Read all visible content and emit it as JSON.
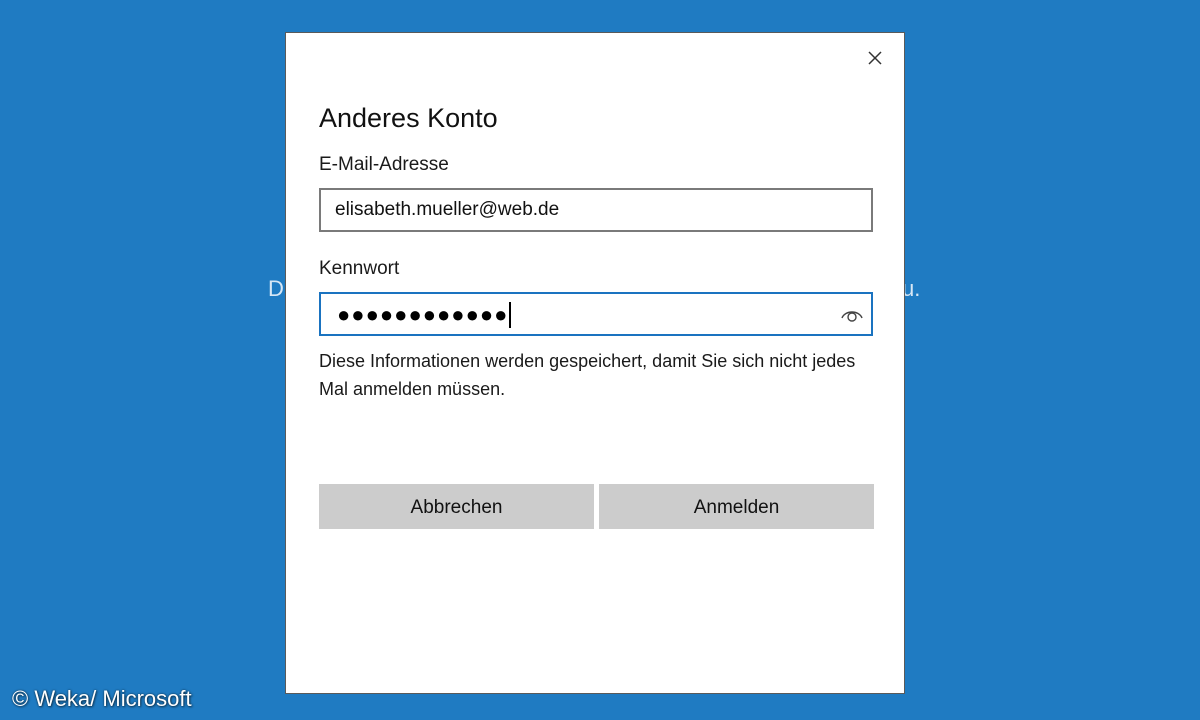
{
  "background": {
    "color": "#1f7bc2",
    "text_left": "D",
    "text_right": "u."
  },
  "watermark": "© Weka/ Microsoft",
  "dialog": {
    "title": "Anderes Konto",
    "close_icon": "close-icon",
    "email": {
      "label": "E-Mail-Adresse",
      "value": "elisabeth.mueller@web.de"
    },
    "password": {
      "label": "Kennwort",
      "masked_value": "●●●●●●●●●●●●",
      "reveal_icon": "eye-icon"
    },
    "info": "Diese Informationen werden gespeichert, damit Sie sich nicht jedes Mal anmelden müssen.",
    "buttons": {
      "cancel": "Abbrechen",
      "login": "Anmelden"
    },
    "colors": {
      "focus_border": "#1a73c0",
      "button_bg": "#cccccc"
    }
  }
}
